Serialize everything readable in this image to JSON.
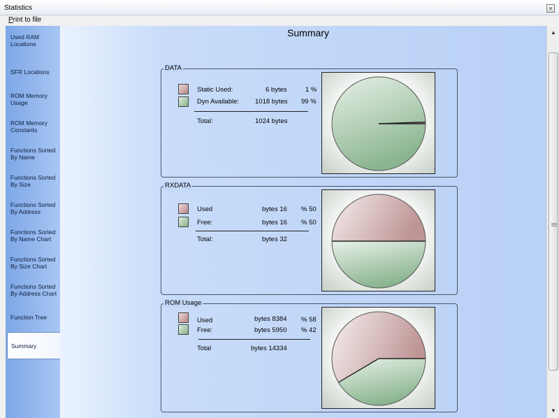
{
  "window": {
    "title": "Statistics",
    "close_glyph": "×"
  },
  "menu": {
    "print_to_file": "Print to file"
  },
  "sidebar": {
    "items": [
      {
        "label": "Used RAM Locations"
      },
      {
        "label": "SFR Locations"
      },
      {
        "label": "ROM Memory Usage"
      },
      {
        "label": "ROM Memory Constants"
      },
      {
        "label": "Functions Sorted By  Name"
      },
      {
        "label": "Functions Sorted By Size"
      },
      {
        "label": "Functions Sorted By Address"
      },
      {
        "label": "Functions Sorted By Name Chart"
      },
      {
        "label": "Functions Sorted By Size Chart"
      },
      {
        "label": "Functions Sorted By Address Chart"
      },
      {
        "label": "Function Tree"
      },
      {
        "label": "Summary"
      }
    ],
    "active_index": 11
  },
  "page": {
    "title": "Summary"
  },
  "sections": [
    {
      "title": "DATA",
      "rows": [
        {
          "label": "Static Used:",
          "value": "6 bytes",
          "pct": "1 %"
        },
        {
          "label": "Dyn Available:",
          "value": "1018 bytes",
          "pct": "99 %"
        }
      ],
      "total": {
        "label": "Total:",
        "value": "1024 bytes"
      }
    },
    {
      "title": "RXDATA",
      "rows": [
        {
          "label": "Used",
          "value": "bytes 16",
          "pct": "% 50"
        },
        {
          "label": "Free:",
          "value": "bytes 16",
          "pct": "% 50"
        }
      ],
      "total": {
        "label": "Total:",
        "value": "bytes 32"
      }
    },
    {
      "title": "ROM Usage",
      "rows": [
        {
          "label": "Used",
          "value": "bytes 8384",
          "pct": "% 58"
        },
        {
          "label": "Free:",
          "value": "bytes 5950",
          "pct": "% 42"
        }
      ],
      "total": {
        "label": "Total",
        "value": "bytes 14334"
      }
    }
  ],
  "scrollbar": {
    "up_glyph": "▲",
    "down_glyph": "▼"
  },
  "chart_data": [
    {
      "type": "pie",
      "categories": [
        "Static Used:",
        "Dyn Available:"
      ],
      "values": [
        6,
        1018
      ],
      "colors": [
        "#b88a8a",
        "#7fae85"
      ]
    },
    {
      "type": "pie",
      "categories": [
        "Used",
        "Free:"
      ],
      "values": [
        16,
        16
      ],
      "colors": [
        "#b88a8a",
        "#7fae85"
      ]
    },
    {
      "type": "pie",
      "categories": [
        "Used",
        "Free:"
      ],
      "values": [
        8384,
        5950
      ],
      "colors": [
        "#b88a8a",
        "#7fae85"
      ]
    }
  ]
}
